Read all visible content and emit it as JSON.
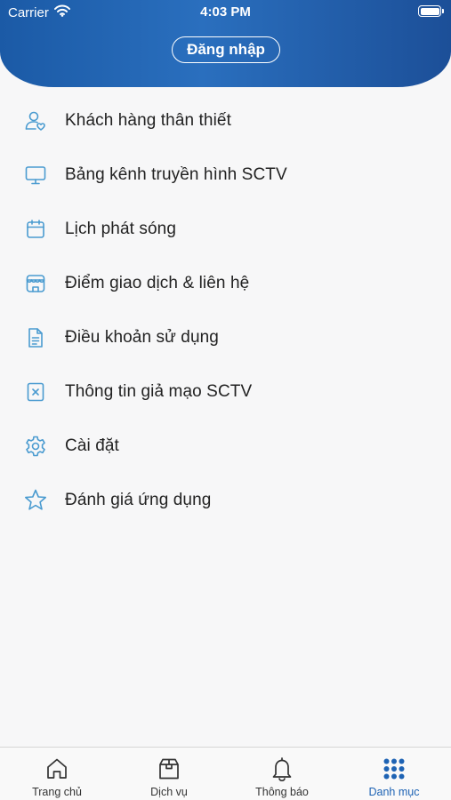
{
  "status_bar": {
    "carrier": "Carrier",
    "time": "4:03 PM"
  },
  "header": {
    "login_label": "Đăng nhập"
  },
  "menu": {
    "items": [
      {
        "label": "Khách hàng thân thiết",
        "icon": "loyal-customer-icon"
      },
      {
        "label": "Bảng kênh truyền hình SCTV",
        "icon": "tv-monitor-icon"
      },
      {
        "label": "Lịch phát sóng",
        "icon": "calendar-icon"
      },
      {
        "label": "Điểm giao dịch & liên hệ",
        "icon": "store-icon"
      },
      {
        "label": "Điều khoản sử dụng",
        "icon": "document-icon"
      },
      {
        "label": "Thông tin giả mạo SCTV",
        "icon": "x-box-icon"
      },
      {
        "label": "Cài đặt",
        "icon": "gear-icon"
      },
      {
        "label": "Đánh giá ứng dụng",
        "icon": "star-icon"
      }
    ]
  },
  "tabbar": {
    "tabs": [
      {
        "label": "Trang chủ",
        "icon": "home-icon"
      },
      {
        "label": "Dịch vụ",
        "icon": "box-icon"
      },
      {
        "label": "Thông báo",
        "icon": "bell-icon"
      },
      {
        "label": "Danh mục",
        "icon": "grid-icon",
        "active": true
      }
    ]
  },
  "colors": {
    "header": "#1b5aa6",
    "accent": "#1e63b4",
    "icon": "#4a9bd0"
  }
}
